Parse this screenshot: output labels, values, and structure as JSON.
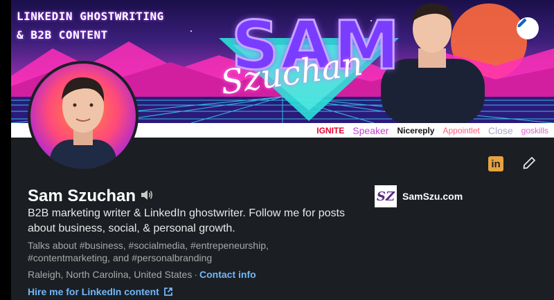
{
  "banner": {
    "tagline_line1": "LINKEDIN GHOSTWRITING",
    "tagline_line2": "& B2B CONTENT",
    "logo_text": "SAM",
    "script_text": "Szuchan",
    "sponsors": [
      "IGNITE",
      "Speaker",
      "Nicereply",
      "Appointlet",
      "Close",
      "goskills"
    ],
    "edit_icon": "pencil-icon"
  },
  "profile": {
    "name": "Sam Szuchan",
    "headline": "B2B marketing writer & LinkedIn ghostwriter. Follow me for posts about business, social, & personal growth.",
    "talks_about": "Talks about #business, #socialmedia, #entrepeneurship, #contentmarketing, and #personalbranding",
    "location": "Raleigh, North Carolina, United States",
    "separator": "·",
    "contact_info_label": "Contact info",
    "hire_label": "Hire me for LinkedIn content",
    "website_logo_text": "SZ",
    "website_name": "SamSzu.com",
    "li_badge": "in"
  },
  "colors": {
    "background": "#1b1f23",
    "link": "#71b7fb",
    "linkedin_badge": "#e7a33e"
  }
}
